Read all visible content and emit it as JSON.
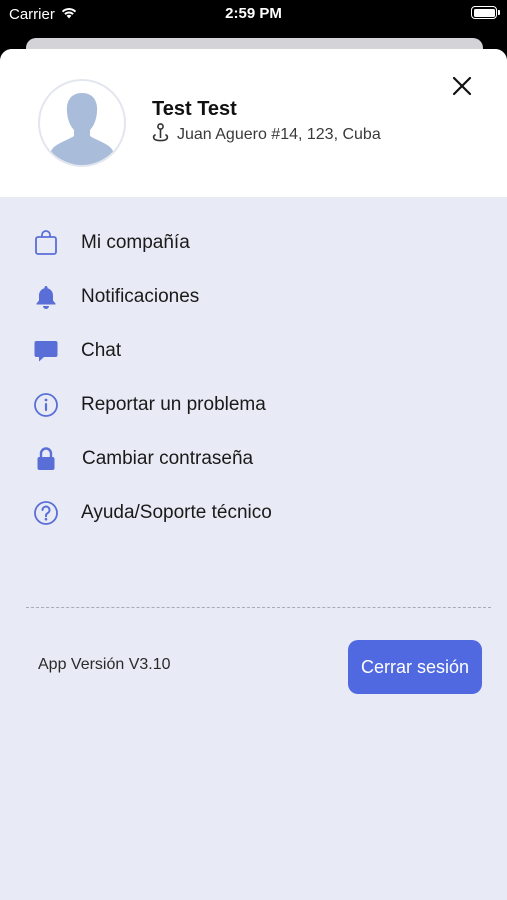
{
  "status_bar": {
    "carrier": "Carrier",
    "time": "2:59 PM",
    "wifi_icon": "wifi-icon",
    "battery_icon": "battery-icon"
  },
  "profile": {
    "name": "Test Test",
    "address": "Juan Aguero #14, 123, Cuba",
    "avatar_icon": "person-silhouette-icon",
    "location_icon": "location-pin-icon",
    "close_icon": "close-icon"
  },
  "menu": {
    "items": [
      {
        "label": "Mi compañía",
        "icon": "shopping-bag-icon"
      },
      {
        "label": "Notificaciones",
        "icon": "bell-icon"
      },
      {
        "label": "Chat",
        "icon": "chat-bubble-icon"
      },
      {
        "label": "Reportar un problema",
        "icon": "info-icon"
      },
      {
        "label": "Cambiar contraseña",
        "icon": "lock-icon"
      },
      {
        "label": "Ayuda/Soporte técnico",
        "icon": "question-icon"
      }
    ]
  },
  "footer": {
    "app_version": "App Versión V3.10",
    "logout_label": "Cerrar sesión"
  },
  "colors": {
    "accent": "#5069e0",
    "sheet_background": "#e8ebf5",
    "header_background": "#ffffff",
    "icon_color": "#5a6ed8",
    "avatar_color": "#a9bcd9"
  }
}
